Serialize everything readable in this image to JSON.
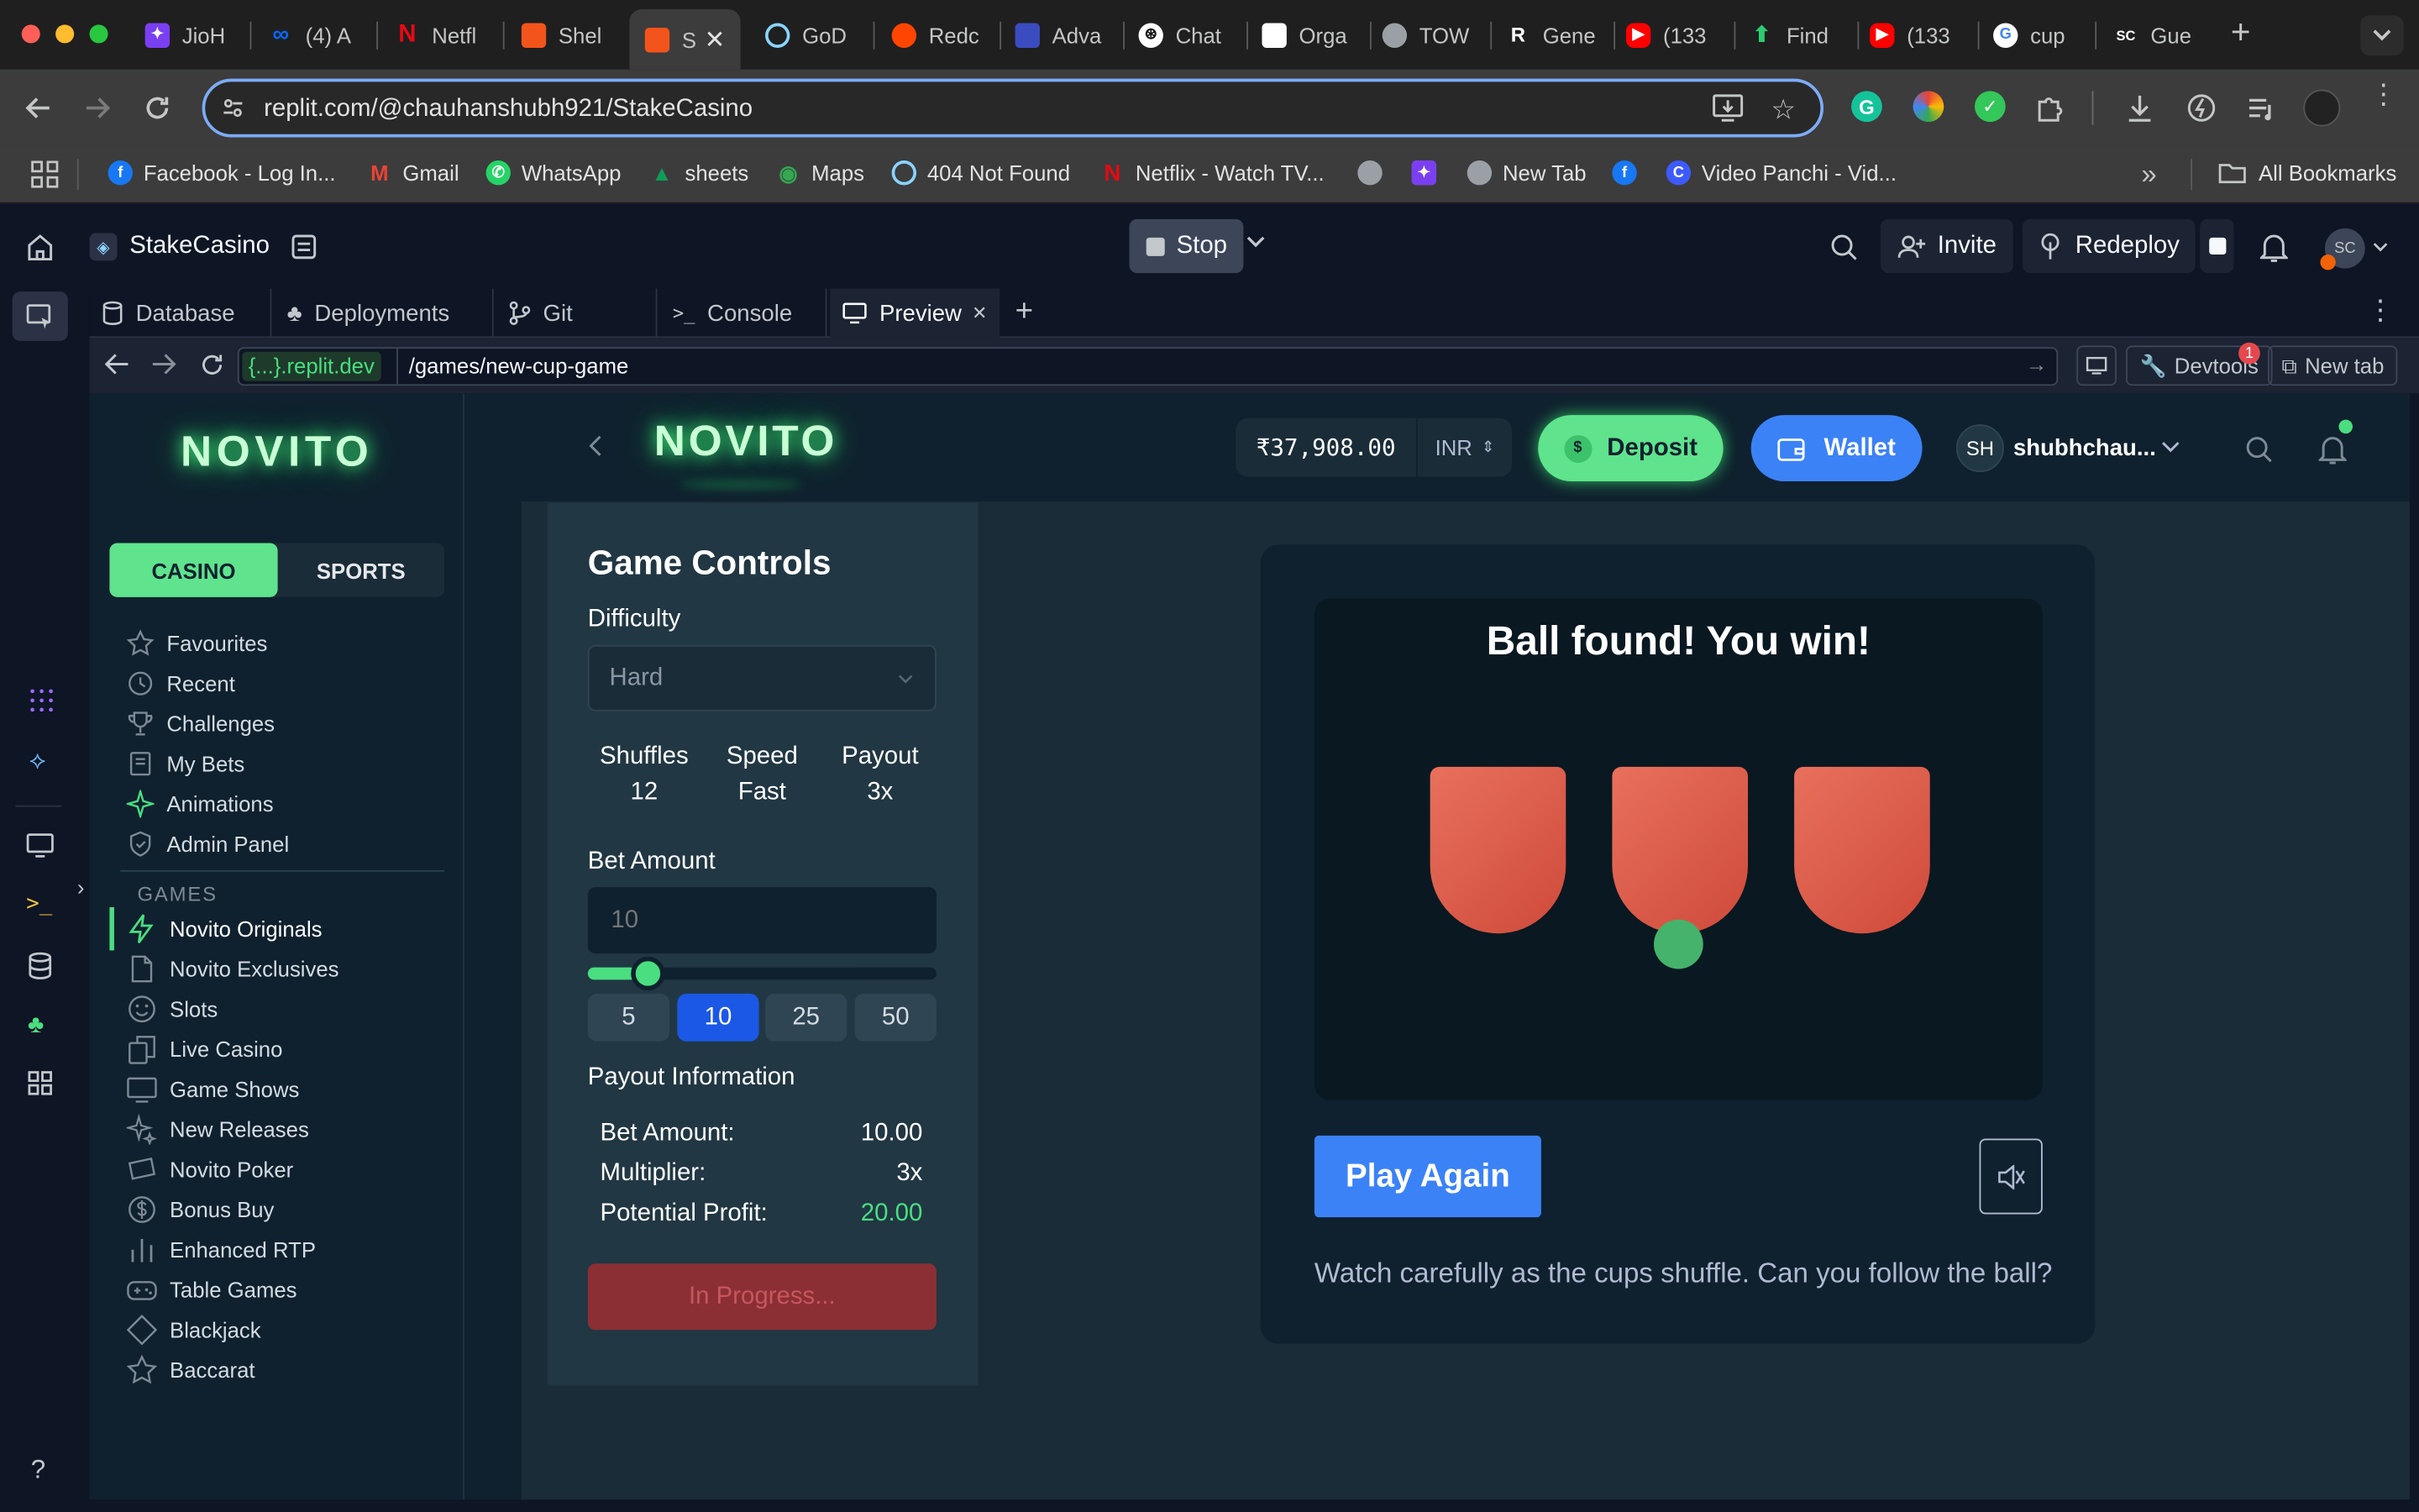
{
  "browser": {
    "tabs": [
      {
        "label": "JioH",
        "color": "#7b3ff2"
      },
      {
        "label": "(4) A",
        "color": "#0866ff"
      },
      {
        "label": "Netfl",
        "color": "#e50914"
      },
      {
        "label": "Shel",
        "color": "#f2541b"
      },
      {
        "label": "S",
        "color": "#f2541b"
      },
      {
        "label": "GoD",
        "color": "#8ad3ff"
      },
      {
        "label": "Redc",
        "color": "#ff4500"
      },
      {
        "label": "Adva",
        "color": "#3b4cc0"
      },
      {
        "label": "Chat",
        "color": "#ffffff"
      },
      {
        "label": "Orga",
        "color": "#ffffff"
      },
      {
        "label": "TOW",
        "color": "#9aa0a6"
      },
      {
        "label": "Gene",
        "color": "#222222"
      },
      {
        "label": "(133",
        "color": "#ff0000"
      },
      {
        "label": "Find",
        "color": "#2ecc71"
      },
      {
        "label": "(133",
        "color": "#ff0000"
      },
      {
        "label": "cup",
        "color": "#4285f4"
      },
      {
        "label": "Gue",
        "color": "#111111"
      }
    ],
    "address": "replit.com/@chauhanshubh921/StakeCasino",
    "bookmarks": [
      {
        "label": "Facebook - Log In...",
        "color": "#1877f2"
      },
      {
        "label": "Gmail",
        "color": "#ea4335"
      },
      {
        "label": "WhatsApp",
        "color": "#25d366"
      },
      {
        "label": "sheets",
        "color": "#0f9d58"
      },
      {
        "label": "Maps",
        "color": "#34a853"
      },
      {
        "label": "404 Not Found",
        "color": "#8ad3ff"
      },
      {
        "label": "Netflix - Watch TV...",
        "color": "#e50914"
      },
      {
        "label": "New Tab",
        "color": "#9aa0a6"
      },
      {
        "label": "Video Panchi - Vid...",
        "color": "#3d5afe"
      }
    ],
    "all_bookmarks": "All Bookmarks",
    "profile_initials": "SC"
  },
  "replit": {
    "project": "StakeCasino",
    "stop": "Stop",
    "invite": "Invite",
    "redeploy": "Redeploy",
    "tabs": [
      "Database",
      "Deployments",
      "Git",
      "Console",
      "Preview"
    ],
    "url_host": "{...}.replit.dev",
    "url_path": "/games/new-cup-game",
    "devtools": "Devtools",
    "devtools_badge": "1",
    "new_tab": "New tab"
  },
  "app": {
    "logo": "NOVITO",
    "mode_tabs": {
      "casino": "CASINO",
      "sports": "SPORTS"
    },
    "nav_top": [
      {
        "label": "Favourites",
        "icon": "star-icon"
      },
      {
        "label": "Recent",
        "icon": "clock-icon"
      },
      {
        "label": "Challenges",
        "icon": "trophy-icon"
      },
      {
        "label": "My Bets",
        "icon": "receipt-icon"
      },
      {
        "label": "Animations",
        "icon": "sparkle-icon"
      },
      {
        "label": "Admin Panel",
        "icon": "shield-icon"
      }
    ],
    "games_heading": "GAMES",
    "nav_games": [
      {
        "label": "Novito Originals",
        "icon": "bolt-icon"
      },
      {
        "label": "Novito Exclusives",
        "icon": "document-icon"
      },
      {
        "label": "Slots",
        "icon": "smiley-icon"
      },
      {
        "label": "Live Casino",
        "icon": "cards-icon"
      },
      {
        "label": "Game Shows",
        "icon": "monitor-icon"
      },
      {
        "label": "New Releases",
        "icon": "sparkle-icon"
      },
      {
        "label": "Novito Poker",
        "icon": "ticket-icon"
      },
      {
        "label": "Bonus Buy",
        "icon": "dollar-icon"
      },
      {
        "label": "Enhanced RTP",
        "icon": "bars-icon"
      },
      {
        "label": "Table Games",
        "icon": "gamepad-icon"
      },
      {
        "label": "Blackjack",
        "icon": "diamond-icon"
      },
      {
        "label": "Baccarat",
        "icon": "star-icon"
      }
    ],
    "balance": "₹37,908.00",
    "currency": "INR",
    "deposit": "Deposit",
    "deposit_glyph": "$",
    "wallet": "Wallet",
    "user_initials": "SH",
    "username": "shubhchau...",
    "controls": {
      "title": "Game Controls",
      "difficulty_label": "Difficulty",
      "difficulty_value": "Hard",
      "stats": [
        {
          "label": "Shuffles",
          "value": "12"
        },
        {
          "label": "Speed",
          "value": "Fast"
        },
        {
          "label": "Payout",
          "value": "3x"
        }
      ],
      "bet_label": "Bet Amount",
      "bet_placeholder": "10",
      "bet_slider_fraction": 0.1,
      "chips": [
        "5",
        "10",
        "25",
        "50"
      ],
      "payout_title": "Payout Information",
      "payout_rows": [
        {
          "label": "Bet Amount:",
          "value": "10.00"
        },
        {
          "label": "Multiplier:",
          "value": "3x"
        },
        {
          "label": "Potential Profit:",
          "value": "20.00"
        }
      ],
      "action_button": "In Progress..."
    },
    "game": {
      "result": "Ball found! You win!",
      "play_again": "Play Again",
      "hint": "Watch carefully as the cups shuffle. Can you follow the ball?"
    },
    "colors": {
      "accent_green": "#00e701",
      "deposit_green": "#5fe38d",
      "wallet_blue": "#3b82f6",
      "cup_red": "#e0604f",
      "profit_green": "#4ade80"
    }
  }
}
